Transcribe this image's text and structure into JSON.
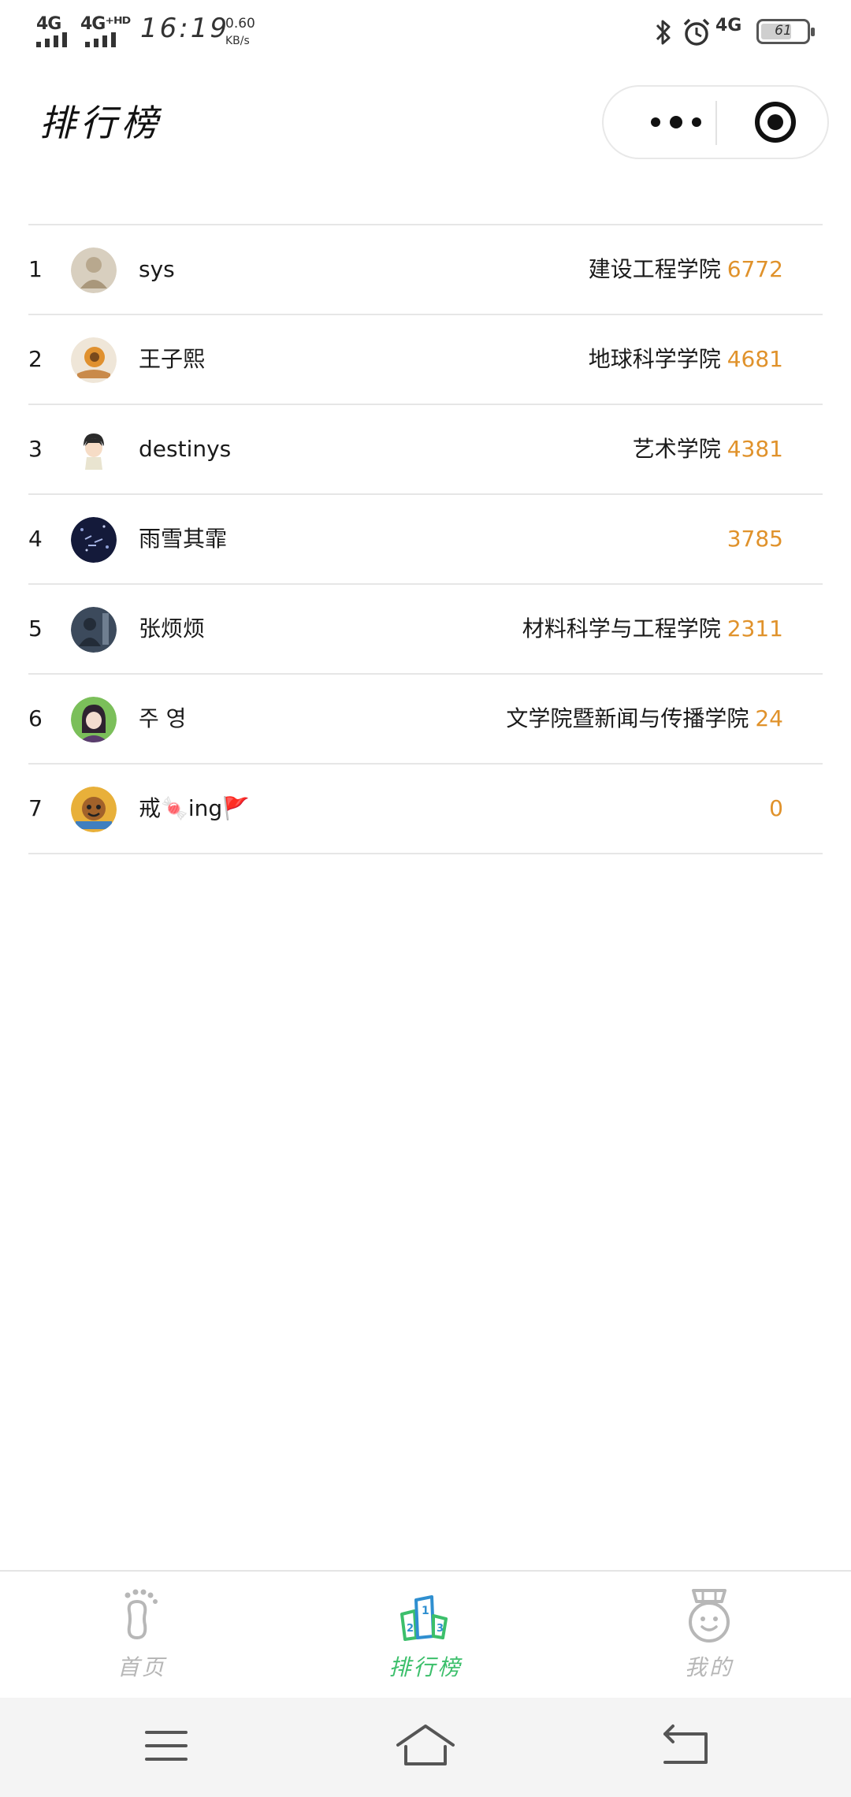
{
  "status_bar": {
    "signal_1": "4G",
    "signal_2": "4G⁺ᴴᴰ",
    "time": "16:19",
    "net_speed": "0.60",
    "net_speed_unit": "KB/s",
    "network_right": "4G",
    "battery_level": "61",
    "icons": [
      "bluetooth-icon",
      "alarm-icon",
      "battery-icon"
    ]
  },
  "header": {
    "title": "排行榜",
    "capsule_icons": [
      "more-dots-icon",
      "close-target-icon"
    ]
  },
  "leaderboard": [
    {
      "rank": "1",
      "name": "sys",
      "college": "建设工程学院",
      "score": "6772"
    },
    {
      "rank": "2",
      "name": "王子熙",
      "college": "地球科学学院",
      "score": "4681"
    },
    {
      "rank": "3",
      "name": "destinys",
      "college": "艺术学院",
      "score": "4381"
    },
    {
      "rank": "4",
      "name": "雨雪其霏",
      "college": "",
      "score": "3785"
    },
    {
      "rank": "5",
      "name": "张烦烦",
      "college": "材料科学与工程学院",
      "score": "2311"
    },
    {
      "rank": "6",
      "name": "주 영",
      "college": "文学院暨新闻与传播学院",
      "score": "24"
    },
    {
      "rank": "7",
      "name": "戒🍬ing🚩",
      "college": "",
      "score": "0"
    }
  ],
  "tab_bar": {
    "tabs": [
      {
        "label": "首页",
        "icon": "footprint-icon",
        "active": false
      },
      {
        "label": "排行榜",
        "icon": "podium-icon",
        "active": true
      },
      {
        "label": "我的",
        "icon": "medal-face-icon",
        "active": false
      }
    ]
  },
  "nav_bar": {
    "icons": [
      "menu-icon",
      "home-icon",
      "back-icon"
    ]
  },
  "colors": {
    "score": "#e0922b",
    "tab_active": "#3cbf6b",
    "tab_inactive": "#b7b7b7",
    "divider": "#e6e6e6"
  }
}
